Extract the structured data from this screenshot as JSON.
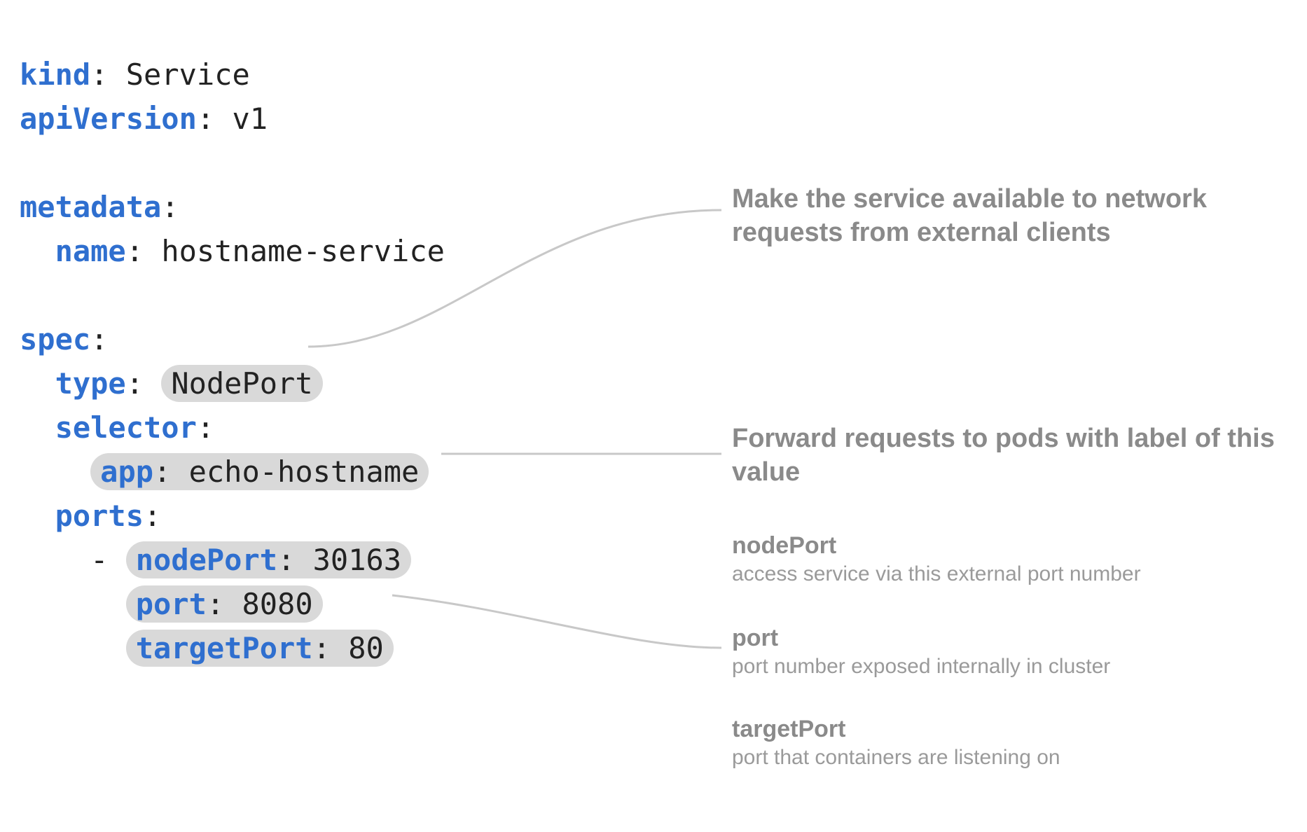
{
  "code": {
    "kind_key": "kind",
    "kind_val": "Service",
    "apiVersion_key": "apiVersion",
    "apiVersion_val": "v1",
    "metadata_key": "metadata",
    "name_key": "name",
    "name_val": "hostname-service",
    "spec_key": "spec",
    "type_key": "type",
    "type_val": "NodePort",
    "selector_key": "selector",
    "app_key": "app",
    "app_val": "echo-hostname",
    "ports_key": "ports",
    "nodePort_key": "nodePort",
    "nodePort_val": "30163",
    "port_key": "port",
    "port_val": "8080",
    "targetPort_key": "targetPort",
    "targetPort_val": "80"
  },
  "annotations": {
    "type_note": "Make the service available to network requests from external clients",
    "selector_note": "Forward requests to pods with label of this value",
    "nodePort_term": "nodePort",
    "nodePort_desc": "access service via this external port number",
    "port_term": "port",
    "port_desc": "port number exposed internally in cluster",
    "targetPort_term": "targetPort",
    "targetPort_desc": "port that containers are listening on"
  }
}
